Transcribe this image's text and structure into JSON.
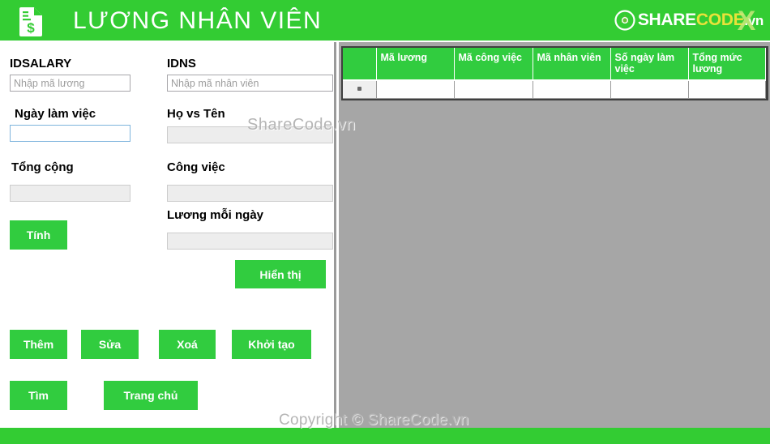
{
  "header": {
    "title": "LƯƠNG NHÂN VIÊN",
    "icon": "salary-document-icon",
    "brand": {
      "part1": "SHARE",
      "part2": "CODE",
      "part3": ".vn",
      "x_mark": "X",
      "logo_icon": "sharecode-circle-logo"
    },
    "bg_color": "#33cc33"
  },
  "form": {
    "idsalary": {
      "label": "IDSALARY",
      "placeholder": "Nhập mã lương",
      "value": ""
    },
    "idns": {
      "label": "IDNS",
      "placeholder": "Nhập mã nhân viên",
      "value": ""
    },
    "ngay_lam_viec": {
      "label": "Ngày làm việc",
      "placeholder": "",
      "value": ""
    },
    "ho_vs_ten": {
      "label": "Họ vs Tên",
      "placeholder": "",
      "value": ""
    },
    "tong_cong": {
      "label": "Tổng cộng",
      "placeholder": "",
      "value": ""
    },
    "cong_viec": {
      "label": "Công việc",
      "placeholder": "",
      "value": ""
    },
    "luong_moi_ngay": {
      "label": "Lương mỗi ngày",
      "placeholder": "",
      "value": ""
    }
  },
  "buttons": {
    "tinh": "Tính",
    "hien_thi": "Hiển thị",
    "them": "Thêm",
    "sua": "Sửa",
    "xoa": "Xoá",
    "khoi_tao": "Khởi tạo",
    "tim": "Tìm",
    "trang_chu": "Trang chủ",
    "color": "#31cc3f"
  },
  "grid": {
    "columns": [
      "Mã lương",
      "Mã công việc",
      "Mã nhân viên",
      "Số ngày làm việc",
      "Tổng mức lương"
    ],
    "rows": [],
    "new_row_indicator": "*",
    "header_color": "#31cc3f",
    "panel_color": "#a6a6a6"
  },
  "watermarks": {
    "middle": "ShareCode.vn",
    "bottom": "Copyright © ShareCode.vn"
  }
}
